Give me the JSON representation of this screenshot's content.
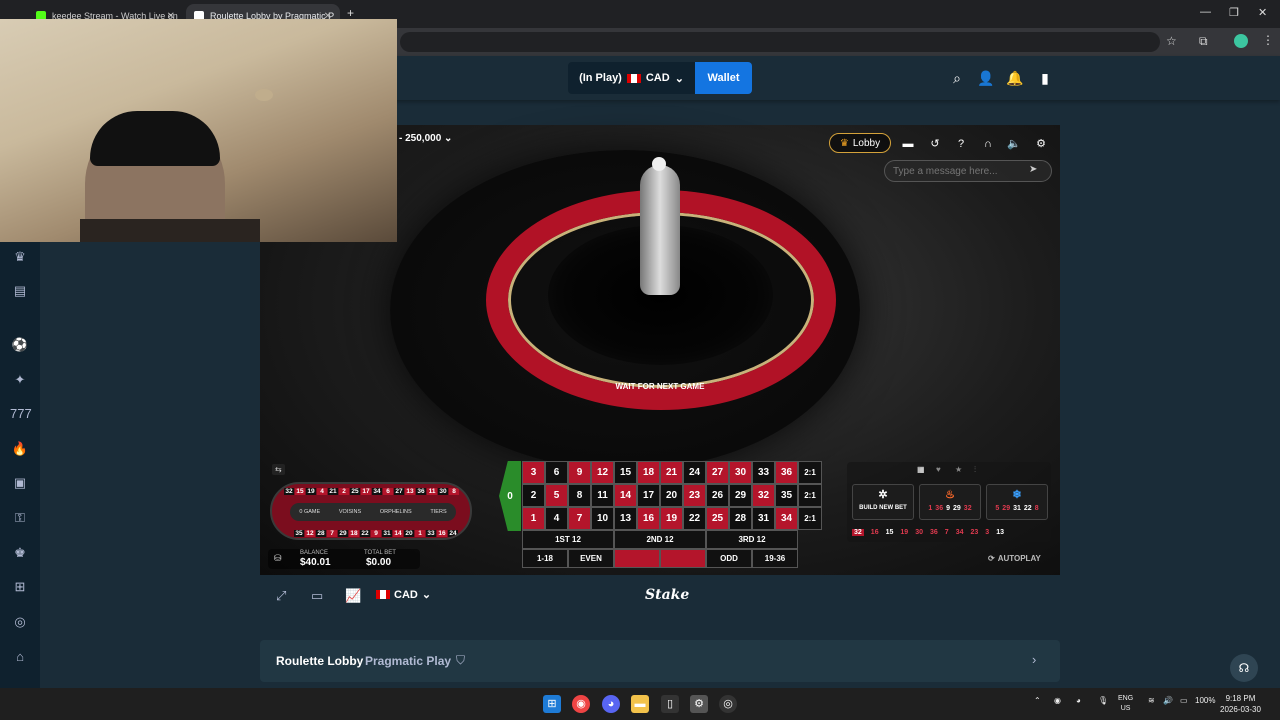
{
  "browser": {
    "tabs": [
      {
        "title": "keedee Stream - Watch Live on",
        "favicon_color": "#53fc18",
        "active": false
      },
      {
        "title": "Roulette Lobby by Pragmatic P",
        "favicon_color": "#ffffff",
        "active": true
      }
    ]
  },
  "topnav": {
    "in_play_label": "(In Play)",
    "currency": "CAD",
    "wallet_label": "Wallet"
  },
  "game": {
    "bet_limit": "- 250,000",
    "lobby_label": "Lobby",
    "chat_placeholder": "Type a message here...",
    "status": "WAIT FOR NEXT GAME",
    "racetrack": {
      "top_numbers": [
        "32",
        "15",
        "19",
        "4",
        "21",
        "2",
        "25",
        "17",
        "34",
        "6",
        "27",
        "13",
        "36",
        "11",
        "30",
        "8"
      ],
      "bottom_numbers": [
        "35",
        "12",
        "28",
        "7",
        "29",
        "18",
        "22",
        "9",
        "31",
        "14",
        "20",
        "1",
        "33",
        "16",
        "24"
      ],
      "left_numbers": [
        "0",
        "26",
        "3"
      ],
      "right_numbers": [
        "23",
        "10",
        "5"
      ],
      "sections": [
        "0 GAME",
        "VOISINS",
        "ORPHELINS",
        "TIERS"
      ]
    },
    "balance_label": "BALANCE",
    "balance_value": "$40.01",
    "total_bet_label": "TOTAL BET",
    "total_bet_value": "$0.00",
    "table": {
      "zero": "0",
      "row_top": [
        [
          "3",
          "r"
        ],
        [
          "6",
          "b"
        ],
        [
          "9",
          "r"
        ],
        [
          "12",
          "r"
        ],
        [
          "15",
          "b"
        ],
        [
          "18",
          "r"
        ],
        [
          "21",
          "r"
        ],
        [
          "24",
          "b"
        ],
        [
          "27",
          "r"
        ],
        [
          "30",
          "r"
        ],
        [
          "33",
          "b"
        ],
        [
          "36",
          "r"
        ]
      ],
      "row_mid": [
        [
          "2",
          "b"
        ],
        [
          "5",
          "r"
        ],
        [
          "8",
          "b"
        ],
        [
          "11",
          "b"
        ],
        [
          "14",
          "r"
        ],
        [
          "17",
          "b"
        ],
        [
          "20",
          "b"
        ],
        [
          "23",
          "r"
        ],
        [
          "26",
          "b"
        ],
        [
          "29",
          "b"
        ],
        [
          "32",
          "r"
        ],
        [
          "35",
          "b"
        ]
      ],
      "row_bot": [
        [
          "1",
          "r"
        ],
        [
          "4",
          "b"
        ],
        [
          "7",
          "r"
        ],
        [
          "10",
          "b"
        ],
        [
          "13",
          "b"
        ],
        [
          "16",
          "r"
        ],
        [
          "19",
          "r"
        ],
        [
          "22",
          "b"
        ],
        [
          "25",
          "r"
        ],
        [
          "28",
          "b"
        ],
        [
          "31",
          "b"
        ],
        [
          "34",
          "r"
        ]
      ],
      "column_label": "2:1",
      "dozens": [
        "1ST 12",
        "2ND 12",
        "3RD 12"
      ],
      "outside": [
        "1-18",
        "EVEN",
        "",
        "",
        "ODD",
        "19-36"
      ]
    },
    "bet_cards": [
      {
        "label": "BUILD NEW BET",
        "numbers": []
      },
      {
        "label": "",
        "numbers": [
          "1",
          "36",
          "9",
          "29",
          "32"
        ]
      },
      {
        "label": "",
        "numbers": [
          "5",
          "29",
          "31",
          "22",
          "8"
        ]
      }
    ],
    "last_results": [
      {
        "n": "32",
        "c": "#e03a4f"
      },
      {
        "n": "16",
        "c": "#e03a4f"
      },
      {
        "n": "15",
        "c": "#ffffff"
      },
      {
        "n": "19",
        "c": "#e03a4f"
      },
      {
        "n": "30",
        "c": "#e03a4f"
      },
      {
        "n": "36",
        "c": "#e03a4f"
      },
      {
        "n": "7",
        "c": "#e03a4f"
      },
      {
        "n": "34",
        "c": "#e03a4f"
      },
      {
        "n": "23",
        "c": "#e03a4f"
      },
      {
        "n": "3",
        "c": "#e03a4f"
      },
      {
        "n": "13",
        "c": "#ffffff"
      }
    ],
    "autoplay_label": "AUTOPLAY"
  },
  "footer": {
    "currency": "CAD",
    "brand": "Stake"
  },
  "lobby_bar": {
    "title": "Roulette Lobby",
    "provider": "Pragmatic Play"
  },
  "taskbar": {
    "lang_top": "ENG",
    "lang_bottom": "US",
    "battery": "100%",
    "time": "9:18 PM",
    "date": "2026-03-30"
  },
  "colors": {
    "wallet_blue": "#1475e1",
    "stake_bg": "#1a2c38",
    "roulette_red": "#b4152b",
    "roulette_green": "#2a8c2a"
  }
}
